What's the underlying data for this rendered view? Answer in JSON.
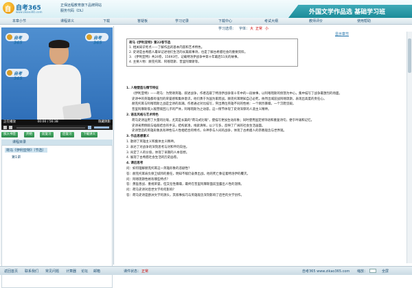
{
  "header": {
    "logo_text": "自考365",
    "logo_glyph": "自",
    "logo_url": "www.zikao365.com",
    "info_line1": "正保远程教育旗下品牌网站",
    "info_line2": "服务代码（DL）",
    "tab_title": "外国文学作品选 基础学习班"
  },
  "nav": [
    "本章小节",
    "课程讲义",
    "下载",
    "答疑板",
    "学习记录",
    "下载中心",
    "考试大纲",
    "教师评价",
    "使用帮助"
  ],
  "video": {
    "logo1": "自考365",
    "logo2": "自考365",
    "logo3": "自考365",
    "status_left": "正在播放",
    "time": "00:00 / 56:38",
    "status_right": "隐藏阴影",
    "progress": 0.0
  },
  "left_buttons": [
    "加入书签",
    "开始",
    "前复习",
    "后复习",
    "下载讲义"
  ],
  "tree": {
    "title": "课程目录",
    "items": [
      {
        "label": "荷马《伊利亚特》（节选）",
        "selected": true
      },
      {
        "label": "第1讲",
        "selected": false
      }
    ]
  },
  "course_bar": {
    "label": "学习选项：",
    "size_label": "字体：",
    "size_big": "大",
    "size_mid": "正常",
    "size_small": "小"
  },
  "outline_link": "显示章节",
  "section_box": [
    "荷马《伊利亚特》第22卷节选",
    "1. 相关知识考点——了解作品的基本内容和艺术特色。",
    "2. 史诗是古希腊人最早记述他们生活的长篇叙事诗，也是了解古希腊社会的重要资料。",
    "3. 《伊利亚特》共24卷，15693行，记载特洛伊战争中第十年最后51天的故事。",
    "4. 主要人物：赫克托耳、阿喀琉斯、普里阿摩斯等。"
  ],
  "content": [
    {
      "type": "h",
      "text": "1. 人物塑造与情节特征"
    },
    {
      "type": "p",
      "text": "《伊利亚特》——荷马：为赞颂英雄、叙述战争，作者选取了特洛伊战争第十年中的一段故事，以阿喀琉斯的愤怒为中心，集中描写了战争最激烈的场面。"
    },
    {
      "type": "p",
      "text": "史诗中的英雄都有强烈的荣誉感和集体意识，他们勇于为国为家而战。赫克托耳明知自己必死，依然出城迎战阿喀琉斯，表现出高度的责任心。"
    },
    {
      "type": "p",
      "text": "赫克托耳与阿喀琉斯之战是全诗的高潮。作者通过对比描写，突出两位英雄不同的性格：一个刚烈暴躁，一个沉稳坚毅。"
    },
    {
      "type": "p",
      "text": "普里阿摩斯夜入敌营赎回儿子的尸体，阿喀琉斯为之动容，这一情节体现了史诗深厚的人道主义精神。"
    },
    {
      "type": "h",
      "text": "2. 语言风格与艺术特色"
    },
    {
      "type": "p",
      "text": "荷马史诗运用了大量的比喻，尤其是长篇的\"荷马式比喻\"，使描写更加生动形象；同时使用固定修饰语和重复诗句，便于吟诵和记忆。"
    },
    {
      "type": "p",
      "text": "史诗采用倒叙与插叙结合的手法，结构紧凑，线索清晰，以少写多，反映了广阔的社会生活画面。"
    },
    {
      "type": "p",
      "text": "史诗塑造的英雄形象具有神性与人性相结合的特点，众神参与人间的战争，体现了古希腊人的宗教观念与世界观。"
    },
    {
      "type": "h",
      "text": "3. 作品思想意义"
    },
    {
      "type": "c",
      "text": "1. 歌颂了英雄主义和集体主义精神。"
    },
    {
      "type": "c",
      "text": "2. 表达了对战争的深刻思考与对和平的向往。"
    },
    {
      "type": "c",
      "text": "3. 肯定了人的价值，体现了早期的人本思想。"
    },
    {
      "type": "c",
      "text": "4. 展现了古希腊社会生活的历史画卷。"
    },
    {
      "type": "h",
      "text": "4. 课后思考"
    },
    {
      "type": "c",
      "text": "问：如何理解赫克托耳这一英雄形象的悲剧性？"
    },
    {
      "type": "c",
      "text": "答：赫克托耳肩负保卫城邦的重任，明知不敌仍奋勇出战，他的死亡象征着特洛伊的覆灭。"
    },
    {
      "type": "c",
      "text": "问：阿喀琉斯性格有哪些特点？"
    },
    {
      "type": "c",
      "text": "答：勇猛善战、重视荣誉，但又任性暴躁，最终在普里阿摩斯面前显露出人性的温情。"
    },
    {
      "type": "c",
      "text": "问：荷马史诗对后世文学有何影响？"
    },
    {
      "type": "c",
      "text": "答：荷马史诗是欧洲文学的源头，其叙事技巧与英雄观念深刻影响了后世的文学创作。"
    }
  ],
  "bottom": {
    "items": [
      "返回首页",
      "联系我们",
      "常见问题",
      "计算器",
      "论坛",
      "邮箱"
    ],
    "status_label": "课件状态：",
    "status_value": "正常",
    "copyright": "自考365 www.zikao365.com",
    "zoom_label": "缩放：",
    "fullscreen": "全屏"
  }
}
